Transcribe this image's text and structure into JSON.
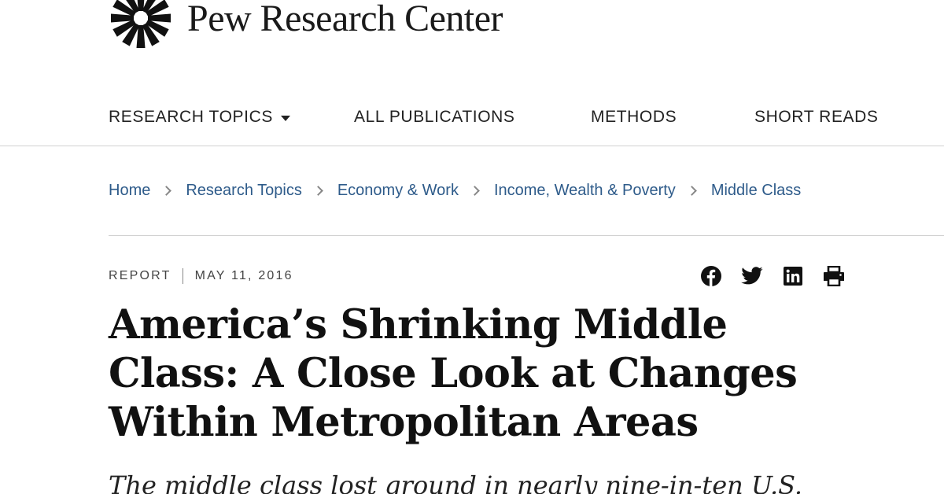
{
  "brand": {
    "name": "Pew Research Center",
    "logo_icon": "starburst-icon"
  },
  "nav": {
    "items": [
      {
        "label": "RESEARCH TOPICS",
        "has_dropdown": true
      },
      {
        "label": "ALL PUBLICATIONS"
      },
      {
        "label": "METHODS"
      },
      {
        "label": "SHORT READS"
      }
    ]
  },
  "breadcrumb": [
    "Home",
    "Research Topics",
    "Economy & Work",
    "Income, Wealth & Poverty",
    "Middle Class"
  ],
  "article": {
    "type": "REPORT",
    "date": "MAY 11, 2016",
    "title": "America’s Shrinking Middle Class: A Close Look at Changes Within Metropolitan Areas",
    "dek": "The middle class lost ground in nearly nine-in-ten U.S."
  },
  "share": {
    "icons": [
      "facebook-icon",
      "twitter-icon",
      "linkedin-icon",
      "print-icon"
    ]
  },
  "colors": {
    "link": "#2e5b8a",
    "text": "#111111",
    "rule": "#d0d0d0"
  }
}
